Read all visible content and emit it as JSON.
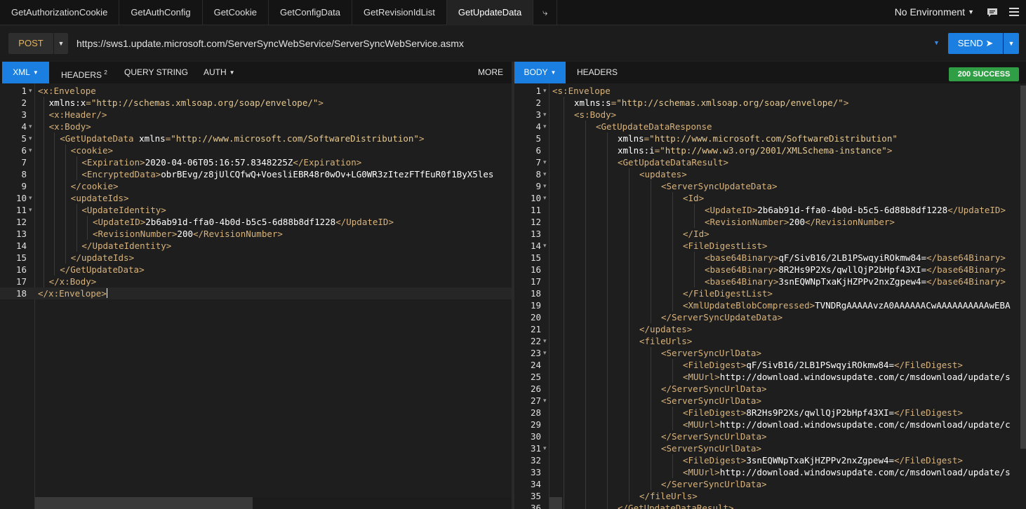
{
  "tabs": [
    {
      "label": "GetAuthorizationCookie",
      "active": false
    },
    {
      "label": "GetAuthConfig",
      "active": false
    },
    {
      "label": "GetCookie",
      "active": false
    },
    {
      "label": "GetConfigData",
      "active": false
    },
    {
      "label": "GetRevisionIdList",
      "active": false
    },
    {
      "label": "GetUpdateData",
      "active": true
    }
  ],
  "add_tab_glyph": "⤷",
  "environment": "No Environment",
  "icons": {
    "chat": "chat-icon",
    "menu": "menu-icon"
  },
  "request": {
    "method": "POST",
    "url": "https://sws1.update.microsoft.com/ServerSyncWebService/ServerSyncWebService.asmx",
    "send_label": "SEND ➤"
  },
  "request_tabs": {
    "body": "XML",
    "headers": "HEADERS",
    "headers_count": "2",
    "query": "QUERY STRING",
    "auth": "AUTH",
    "more": "MORE"
  },
  "response_tabs": {
    "body": "BODY",
    "headers": "HEADERS"
  },
  "status": "200 SUCCESS",
  "colors": {
    "accent": "#1a7fe0",
    "success": "#2f9e44",
    "tag": "#d9b37b",
    "string": "#e6c88f"
  },
  "request_body": [
    {
      "n": "1",
      "indent": 0,
      "fold": true,
      "segs": [
        [
          "tag",
          "<x:Envelope"
        ]
      ]
    },
    {
      "n": "2",
      "indent": 1,
      "fold": false,
      "segs": [
        [
          "attr",
          "xmlns:x"
        ],
        [
          "tag",
          "="
        ],
        [
          "str",
          "\"http://schemas.xmlsoap.org/soap/envelope/\""
        ],
        [
          "tag",
          ">"
        ]
      ]
    },
    {
      "n": "3",
      "indent": 1,
      "fold": false,
      "segs": [
        [
          "tag",
          "<x:Header/>"
        ]
      ]
    },
    {
      "n": "4",
      "indent": 1,
      "fold": true,
      "segs": [
        [
          "tag",
          "<x:Body>"
        ]
      ]
    },
    {
      "n": "5",
      "indent": 2,
      "fold": true,
      "segs": [
        [
          "tag",
          "<GetUpdateData "
        ],
        [
          "attr",
          "xmlns"
        ],
        [
          "tag",
          "="
        ],
        [
          "str",
          "\"http://www.microsoft.com/SoftwareDistribution\""
        ],
        [
          "tag",
          ">"
        ]
      ]
    },
    {
      "n": "6",
      "indent": 3,
      "fold": true,
      "segs": [
        [
          "tag",
          "<cookie>"
        ]
      ]
    },
    {
      "n": "7",
      "indent": 4,
      "fold": false,
      "segs": [
        [
          "tag",
          "<Expiration>"
        ],
        [
          "txt",
          "2020-04-06T05:16:57.8348225Z"
        ],
        [
          "tag",
          "</Expiration>"
        ]
      ]
    },
    {
      "n": "8",
      "indent": 4,
      "fold": false,
      "segs": [
        [
          "tag",
          "<EncryptedData>"
        ],
        [
          "txt",
          "obrBEvg/z8jUlCQfwQ+VoesliEBR48r0wOv+LG0WR3zItezFTfEuR0f1ByX5les"
        ]
      ]
    },
    {
      "n": "9",
      "indent": 3,
      "fold": false,
      "segs": [
        [
          "tag",
          "</cookie>"
        ]
      ]
    },
    {
      "n": "10",
      "indent": 3,
      "fold": true,
      "segs": [
        [
          "tag",
          "<updateIds>"
        ]
      ]
    },
    {
      "n": "11",
      "indent": 4,
      "fold": true,
      "segs": [
        [
          "tag",
          "<UpdateIdentity>"
        ]
      ]
    },
    {
      "n": "12",
      "indent": 5,
      "fold": false,
      "segs": [
        [
          "tag",
          "<UpdateID>"
        ],
        [
          "txt",
          "2b6ab91d-ffa0-4b0d-b5c5-6d88b8df1228"
        ],
        [
          "tag",
          "</UpdateID>"
        ]
      ]
    },
    {
      "n": "13",
      "indent": 5,
      "fold": false,
      "segs": [
        [
          "tag",
          "<RevisionNumber>"
        ],
        [
          "txt",
          "200"
        ],
        [
          "tag",
          "</RevisionNumber>"
        ]
      ]
    },
    {
      "n": "14",
      "indent": 4,
      "fold": false,
      "segs": [
        [
          "tag",
          "</UpdateIdentity>"
        ]
      ]
    },
    {
      "n": "15",
      "indent": 3,
      "fold": false,
      "segs": [
        [
          "tag",
          "</updateIds>"
        ]
      ]
    },
    {
      "n": "16",
      "indent": 2,
      "fold": false,
      "segs": [
        [
          "tag",
          "</GetUpdateData>"
        ]
      ]
    },
    {
      "n": "17",
      "indent": 1,
      "fold": false,
      "segs": [
        [
          "tag",
          "</x:Body>"
        ]
      ]
    },
    {
      "n": "18",
      "indent": 0,
      "fold": false,
      "cursor": true,
      "segs": [
        [
          "tag",
          "</x:Envelope>"
        ]
      ]
    }
  ],
  "response_body": [
    {
      "n": "1",
      "indent": 0,
      "fold": true,
      "segs": [
        [
          "tag",
          "<s:Envelope"
        ]
      ]
    },
    {
      "n": "2",
      "indent": 1,
      "fold": false,
      "segs": [
        [
          "attr",
          "xmlns:s"
        ],
        [
          "tag",
          "="
        ],
        [
          "str",
          "\"http://schemas.xmlsoap.org/soap/envelope/\""
        ],
        [
          "tag",
          ">"
        ]
      ]
    },
    {
      "n": "3",
      "indent": 1,
      "fold": true,
      "segs": [
        [
          "tag",
          "<s:Body>"
        ]
      ]
    },
    {
      "n": "4",
      "indent": 2,
      "fold": true,
      "segs": [
        [
          "tag",
          "<GetUpdateDataResponse"
        ]
      ]
    },
    {
      "n": "5",
      "indent": 3,
      "fold": false,
      "segs": [
        [
          "attr",
          "xmlns"
        ],
        [
          "tag",
          "="
        ],
        [
          "str",
          "\"http://www.microsoft.com/SoftwareDistribution\""
        ]
      ]
    },
    {
      "n": "6",
      "indent": 3,
      "fold": false,
      "segs": [
        [
          "attr",
          "xmlns:i"
        ],
        [
          "tag",
          "="
        ],
        [
          "str",
          "\"http://www.w3.org/2001/XMLSchema-instance\""
        ],
        [
          "tag",
          ">"
        ]
      ]
    },
    {
      "n": "7",
      "indent": 3,
      "fold": true,
      "segs": [
        [
          "tag",
          "<GetUpdateDataResult>"
        ]
      ]
    },
    {
      "n": "8",
      "indent": 4,
      "fold": true,
      "segs": [
        [
          "tag",
          "<updates>"
        ]
      ]
    },
    {
      "n": "9",
      "indent": 5,
      "fold": true,
      "segs": [
        [
          "tag",
          "<ServerSyncUpdateData>"
        ]
      ]
    },
    {
      "n": "10",
      "indent": 6,
      "fold": true,
      "segs": [
        [
          "tag",
          "<Id>"
        ]
      ]
    },
    {
      "n": "11",
      "indent": 7,
      "fold": false,
      "segs": [
        [
          "tag",
          "<UpdateID>"
        ],
        [
          "txt",
          "2b6ab91d-ffa0-4b0d-b5c5-6d88b8df1228"
        ],
        [
          "tag",
          "</UpdateID>"
        ]
      ]
    },
    {
      "n": "12",
      "indent": 7,
      "fold": false,
      "segs": [
        [
          "tag",
          "<RevisionNumber>"
        ],
        [
          "txt",
          "200"
        ],
        [
          "tag",
          "</RevisionNumber>"
        ]
      ]
    },
    {
      "n": "13",
      "indent": 6,
      "fold": false,
      "segs": [
        [
          "tag",
          "</Id>"
        ]
      ]
    },
    {
      "n": "14",
      "indent": 6,
      "fold": true,
      "segs": [
        [
          "tag",
          "<FileDigestList>"
        ]
      ]
    },
    {
      "n": "15",
      "indent": 7,
      "fold": false,
      "segs": [
        [
          "tag",
          "<base64Binary>"
        ],
        [
          "txt",
          "qF/SivB16/2LB1PSwqyiROkmw84="
        ],
        [
          "tag",
          "</base64Binary>"
        ]
      ]
    },
    {
      "n": "16",
      "indent": 7,
      "fold": false,
      "segs": [
        [
          "tag",
          "<base64Binary>"
        ],
        [
          "txt",
          "8R2Hs9P2Xs/qwllQjP2bHpf43XI="
        ],
        [
          "tag",
          "</base64Binary>"
        ]
      ]
    },
    {
      "n": "17",
      "indent": 7,
      "fold": false,
      "segs": [
        [
          "tag",
          "<base64Binary>"
        ],
        [
          "txt",
          "3snEQWNpTxaKjHZPPv2nxZgpew4="
        ],
        [
          "tag",
          "</base64Binary>"
        ]
      ]
    },
    {
      "n": "18",
      "indent": 6,
      "fold": false,
      "segs": [
        [
          "tag",
          "</FileDigestList>"
        ]
      ]
    },
    {
      "n": "19",
      "indent": 6,
      "fold": false,
      "segs": [
        [
          "tag",
          "<XmlUpdateBlobCompressed>"
        ],
        [
          "txt",
          "TVNDRgAAAAAvzA0AAAAAACwAAAAAAAAAAwEBA"
        ]
      ]
    },
    {
      "n": "20",
      "indent": 5,
      "fold": false,
      "segs": [
        [
          "tag",
          "</ServerSyncUpdateData>"
        ]
      ]
    },
    {
      "n": "21",
      "indent": 4,
      "fold": false,
      "segs": [
        [
          "tag",
          "</updates>"
        ]
      ]
    },
    {
      "n": "22",
      "indent": 4,
      "fold": true,
      "segs": [
        [
          "tag",
          "<fileUrls>"
        ]
      ]
    },
    {
      "n": "23",
      "indent": 5,
      "fold": true,
      "segs": [
        [
          "tag",
          "<ServerSyncUrlData>"
        ]
      ]
    },
    {
      "n": "24",
      "indent": 6,
      "fold": false,
      "segs": [
        [
          "tag",
          "<FileDigest>"
        ],
        [
          "txt",
          "qF/SivB16/2LB1PSwqyiROkmw84="
        ],
        [
          "tag",
          "</FileDigest>"
        ]
      ]
    },
    {
      "n": "25",
      "indent": 6,
      "fold": false,
      "segs": [
        [
          "tag",
          "<MUUrl>"
        ],
        [
          "txt",
          "http://download.windowsupdate.com/c/msdownload/update/s"
        ]
      ]
    },
    {
      "n": "26",
      "indent": 5,
      "fold": false,
      "segs": [
        [
          "tag",
          "</ServerSyncUrlData>"
        ]
      ]
    },
    {
      "n": "27",
      "indent": 5,
      "fold": true,
      "segs": [
        [
          "tag",
          "<ServerSyncUrlData>"
        ]
      ]
    },
    {
      "n": "28",
      "indent": 6,
      "fold": false,
      "segs": [
        [
          "tag",
          "<FileDigest>"
        ],
        [
          "txt",
          "8R2Hs9P2Xs/qwllQjP2bHpf43XI="
        ],
        [
          "tag",
          "</FileDigest>"
        ]
      ]
    },
    {
      "n": "29",
      "indent": 6,
      "fold": false,
      "segs": [
        [
          "tag",
          "<MUUrl>"
        ],
        [
          "txt",
          "http://download.windowsupdate.com/c/msdownload/update/c"
        ]
      ]
    },
    {
      "n": "30",
      "indent": 5,
      "fold": false,
      "segs": [
        [
          "tag",
          "</ServerSyncUrlData>"
        ]
      ]
    },
    {
      "n": "31",
      "indent": 5,
      "fold": true,
      "segs": [
        [
          "tag",
          "<ServerSyncUrlData>"
        ]
      ]
    },
    {
      "n": "32",
      "indent": 6,
      "fold": false,
      "segs": [
        [
          "tag",
          "<FileDigest>"
        ],
        [
          "txt",
          "3snEQWNpTxaKjHZPPv2nxZgpew4="
        ],
        [
          "tag",
          "</FileDigest>"
        ]
      ]
    },
    {
      "n": "33",
      "indent": 6,
      "fold": false,
      "segs": [
        [
          "tag",
          "<MUUrl>"
        ],
        [
          "txt",
          "http://download.windowsupdate.com/c/msdownload/update/s"
        ]
      ]
    },
    {
      "n": "34",
      "indent": 5,
      "fold": false,
      "segs": [
        [
          "tag",
          "</ServerSyncUrlData>"
        ]
      ]
    },
    {
      "n": "35",
      "indent": 4,
      "fold": false,
      "segs": [
        [
          "tag",
          "</fileUrls>"
        ]
      ]
    },
    {
      "n": "36",
      "indent": 3,
      "fold": false,
      "segs": [
        [
          "tag",
          "</GetUpdateDataResult>"
        ]
      ]
    }
  ]
}
